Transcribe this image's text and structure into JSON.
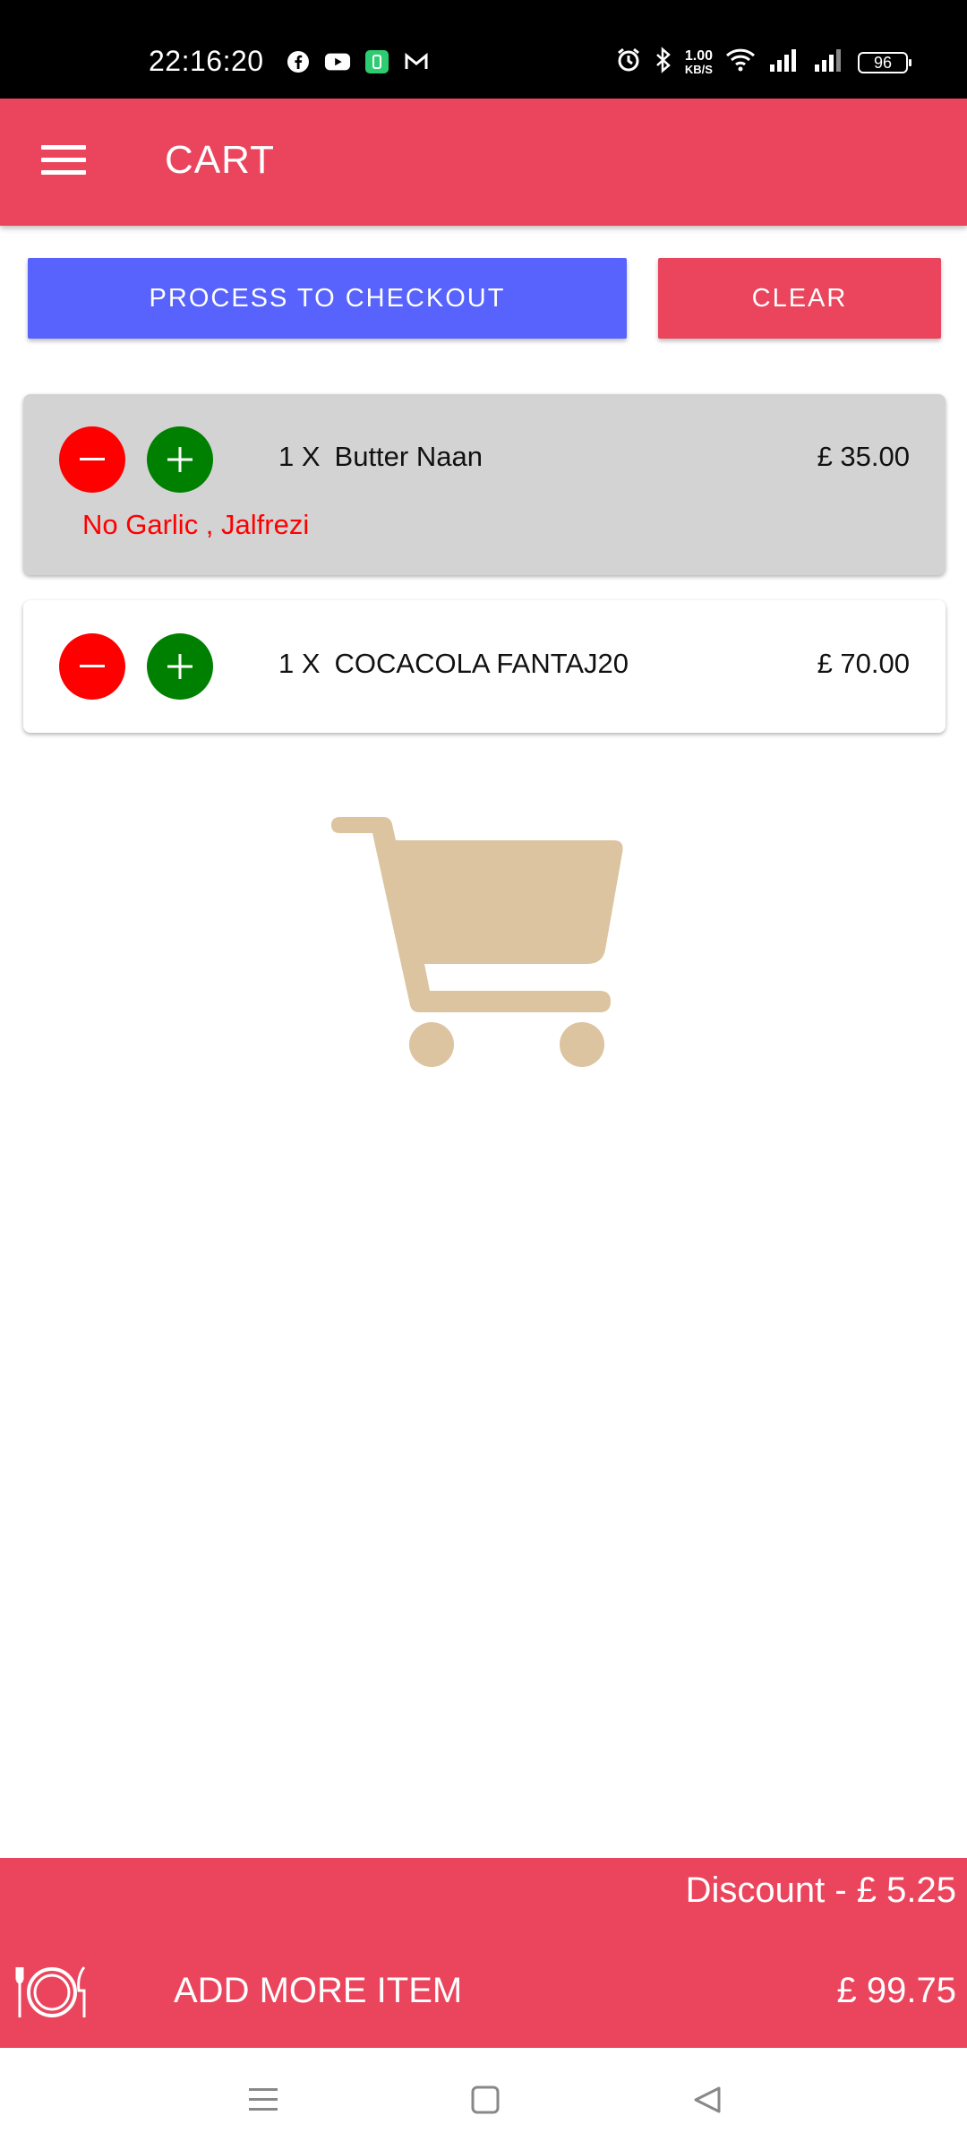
{
  "status_bar": {
    "time": "22:16:20",
    "net_speed_value": "1.00",
    "net_speed_unit": "KB/S",
    "battery_level": "96",
    "app_icons": [
      "facebook-icon",
      "youtube-icon",
      "app-badge-icon",
      "gmail-icon"
    ],
    "system_icons": [
      "alarm-icon",
      "bluetooth-icon",
      "wifi-icon",
      "signal-icon",
      "signal-icon-2",
      "battery-icon"
    ]
  },
  "app_bar": {
    "title": "CART",
    "menu_icon": "hamburger-menu-icon"
  },
  "actions": {
    "checkout_label": "PROCESS TO CHECKOUT",
    "clear_label": "CLEAR"
  },
  "cart_items": [
    {
      "qty": "1 X",
      "name": "Butter Naan",
      "price": "£ 35.00",
      "note": "No Garlic , Jalfrezi",
      "highlighted": true
    },
    {
      "qty": "1 X",
      "name": "COCACOLA FANTAJ20",
      "price": "£ 70.00",
      "note": "",
      "highlighted": false
    }
  ],
  "illustration": {
    "icon": "shopping-cart-icon"
  },
  "bottom_bar": {
    "discount": "Discount - £ 5.25",
    "add_more_label": "ADD MORE ITEM",
    "total": "£ 99.75",
    "plate_icon": "plate-fork-knife-icon"
  },
  "colors": {
    "accent": "#ea455c",
    "checkout_blue": "#5763fc",
    "minus_red": "#ff0000",
    "plus_green": "#008000",
    "note_red": "#ff0000",
    "cart_tan": "#dbc49f",
    "highlight_row": "#d3d3d3"
  }
}
